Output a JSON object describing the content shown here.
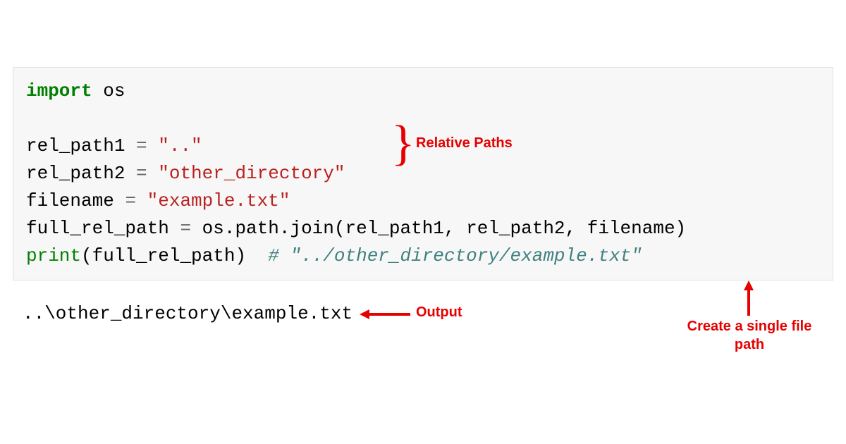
{
  "code": {
    "line1_import": "import",
    "line1_os": " os",
    "line2_blank": "",
    "line3_var": "rel_path1 ",
    "line3_eq": "=",
    "line3_str": " \"..\"",
    "line4_var": "rel_path2 ",
    "line4_eq": "=",
    "line4_str": " \"other_directory\"",
    "line5_var": "filename ",
    "line5_eq": "=",
    "line5_str": " \"example.txt\"",
    "line6_var": "full_rel_path ",
    "line6_eq": "=",
    "line6_rest": " os.path.join(rel_path1, rel_path2, filename)",
    "line7_print": "print",
    "line7_rest": "(full_rel_path)  ",
    "line7_comment": "# \"../other_directory/example.txt\""
  },
  "output": "..\\other_directory\\example.txt",
  "annotations": {
    "relative_paths": "Relative Paths",
    "output_label": "Output",
    "single_file": "Create a single file path"
  }
}
